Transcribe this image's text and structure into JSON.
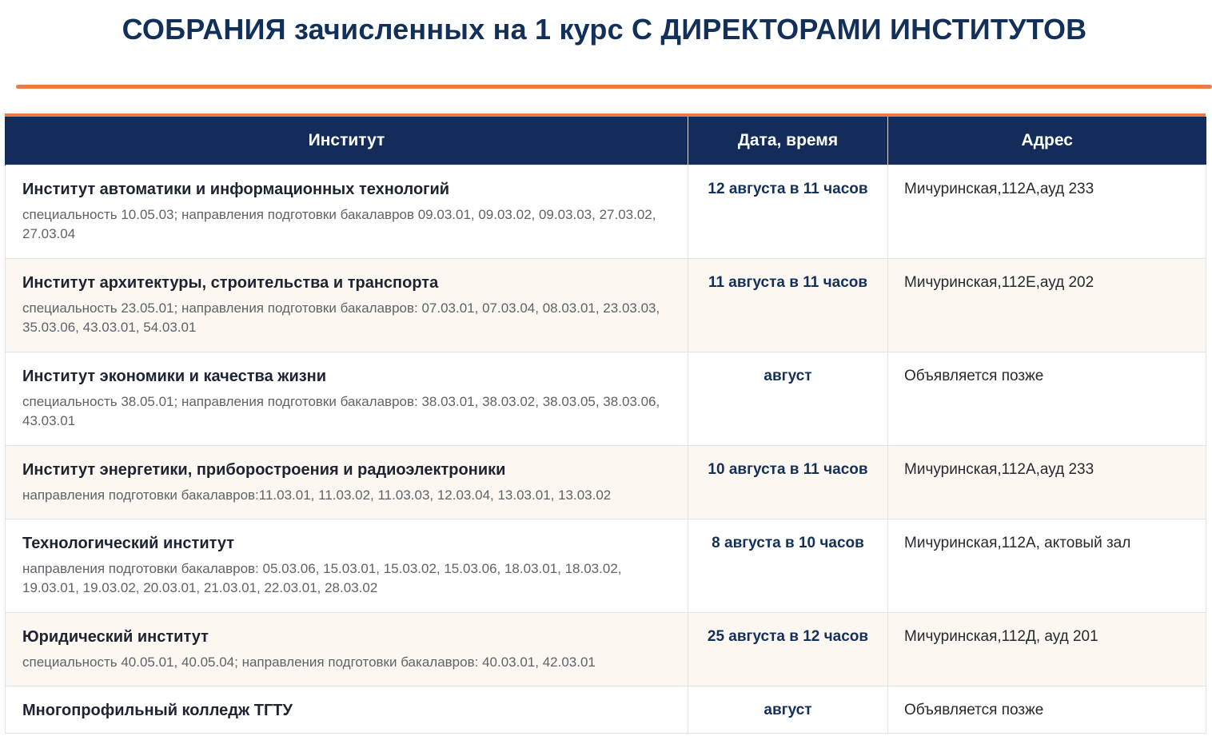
{
  "page": {
    "title": "СОБРАНИЯ зачисленных на 1 курс С ДИРЕКТОРАМИ ИНСТИТУТОВ"
  },
  "colors": {
    "accent_orange": "#ec7a45",
    "header_navy": "#132c59",
    "title_navy": "#13305a",
    "alt_row": "#fcf7f1"
  },
  "table": {
    "headers": [
      "Институт",
      "Дата, время",
      "Адрес"
    ],
    "rows": [
      {
        "institute": "Институт автоматики и информационных технологий",
        "description": "специальность 10.05.03; направления подготовки бакалавров 09.03.01, 09.03.02, 09.03.03, 27.03.02, 27.03.04",
        "date": "12 августа в 11 часов",
        "address": "Мичуринская,112А,ауд 233"
      },
      {
        "institute": "Институт архитектуры, строительства и транспорта",
        "description": "специальность 23.05.01; направления подготовки бакалавров: 07.03.01, 07.03.04, 08.03.01, 23.03.03, 35.03.06, 43.03.01, 54.03.01",
        "date": "11 августа в 11 часов",
        "address": "Мичуринская,112Е,ауд 202"
      },
      {
        "institute": "Институт экономики и качества жизни",
        "description": "специальность 38.05.01; направления подготовки бакалавров: 38.03.01, 38.03.02, 38.03.05, 38.03.06, 43.03.01",
        "date": "август",
        "address": "Объявляется позже"
      },
      {
        "institute": "Институт энергетики, приборостроения и радиоэлектроники",
        "description": "направления подготовки бакалавров:11.03.01, 11.03.02, 11.03.03, 12.03.04, 13.03.01, 13.03.02",
        "date": "10 августа в 11 часов",
        "address": "Мичуринская,112А,ауд 233"
      },
      {
        "institute": "Технологический институт",
        "description": "направления подготовки бакалавров: 05.03.06, 15.03.01, 15.03.02, 15.03.06, 18.03.01, 18.03.02, 19.03.01, 19.03.02, 20.03.01, 21.03.01, 22.03.01, 28.03.02",
        "date": "8 августа в 10 часов",
        "address": "Мичуринская,112А, актовый зал"
      },
      {
        "institute": "Юридический институт",
        "description": "специальность 40.05.01, 40.05.04; направления подготовки бакалавров: 40.03.01, 42.03.01",
        "date": "25 августа в 12 часов",
        "address": "Мичуринская,112Д, ауд 201"
      },
      {
        "institute": "Многопрофильный колледж ТГТУ",
        "description": "",
        "date": "август",
        "address": "Объявляется позже"
      }
    ]
  }
}
